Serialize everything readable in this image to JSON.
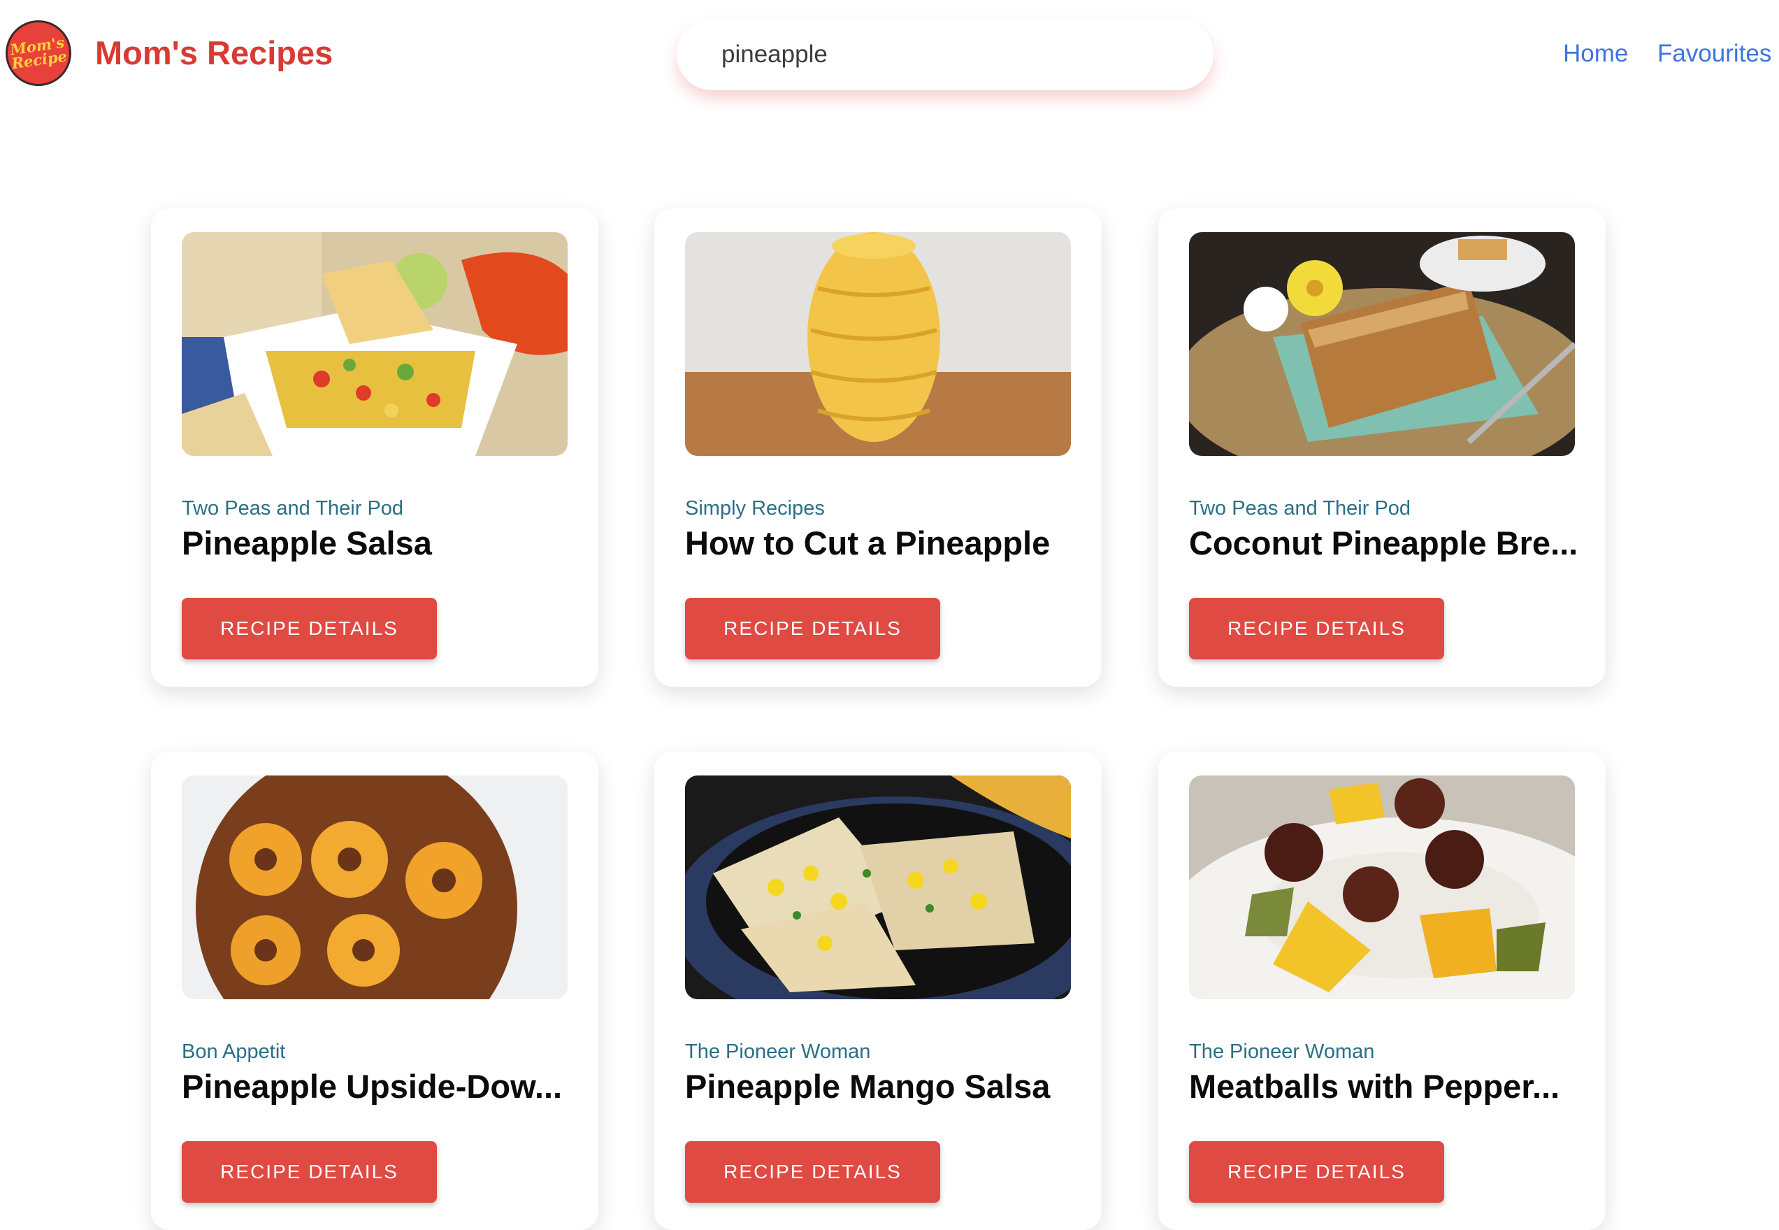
{
  "header": {
    "logo_text": "Mom's\nRecipe",
    "brand": "Mom's Recipes",
    "search_value": "pineapple",
    "nav": {
      "home": "Home",
      "favourites": "Favourites"
    }
  },
  "colors": {
    "brand": "#d83b33",
    "nav_link": "#3f74df",
    "source": "#2b6f86",
    "button": "#df4a43"
  },
  "cards": [
    {
      "source": "Two Peas and Their Pod",
      "title": "Pineapple Salsa",
      "button": "RECIPE DETAILS",
      "image": "pineapple-salsa-photo"
    },
    {
      "source": "Simply Recipes",
      "title": "How to Cut a Pineapple",
      "button": "RECIPE DETAILS",
      "image": "cut-pineapple-photo"
    },
    {
      "source": "Two Peas and Their Pod",
      "title": "Coconut Pineapple Bre...",
      "button": "RECIPE DETAILS",
      "image": "coconut-pineapple-bread-photo"
    },
    {
      "source": "Bon Appetit",
      "title": "Pineapple Upside-Dow...",
      "button": "RECIPE DETAILS",
      "image": "pineapple-upside-down-cake-photo"
    },
    {
      "source": "The Pioneer Woman",
      "title": "Pineapple Mango Salsa",
      "button": "RECIPE DETAILS",
      "image": "pineapple-mango-salsa-photo"
    },
    {
      "source": "The Pioneer Woman",
      "title": "Meatballs with Pepper...",
      "button": "RECIPE DETAILS",
      "image": "meatballs-pepper-photo"
    }
  ]
}
